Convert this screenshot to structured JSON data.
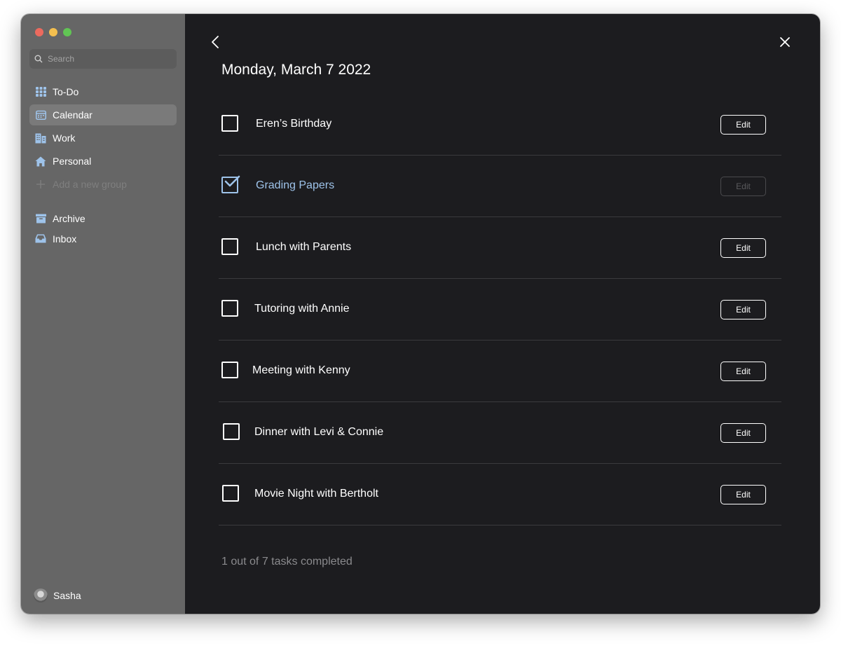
{
  "sidebar": {
    "search_placeholder": "Search",
    "nav": [
      {
        "label": "To-Do",
        "icon": "grid-icon"
      },
      {
        "label": "Calendar",
        "icon": "calendar-icon",
        "active": true
      },
      {
        "label": "Work",
        "icon": "building-icon"
      },
      {
        "label": "Personal",
        "icon": "home-icon"
      },
      {
        "label": "Add a new group",
        "icon": "plus-icon"
      }
    ],
    "nav2": [
      {
        "label": "Archive",
        "icon": "archive-icon"
      },
      {
        "label": "Inbox",
        "icon": "inbox-icon"
      }
    ],
    "user": "Sasha"
  },
  "main": {
    "title": "Monday, March 7 2022",
    "edit_label": "Edit",
    "tasks": [
      {
        "label": "Eren’s Birthday",
        "done": false
      },
      {
        "label": "Grading Papers",
        "done": true
      },
      {
        "label": "Lunch with Parents",
        "done": false
      },
      {
        "label": "Tutoring with Annie",
        "done": false
      },
      {
        "label": "Meeting with Kenny",
        "done": false
      },
      {
        "label": "Dinner with Levi & Connie",
        "done": false
      },
      {
        "label": "Movie Night with Bertholt",
        "done": false
      }
    ],
    "summary": "1 out of 7 tasks completed"
  },
  "colors": {
    "accent": "#9ec3ea",
    "sidebar_bg": "#666666",
    "main_bg": "#1c1c1f"
  }
}
